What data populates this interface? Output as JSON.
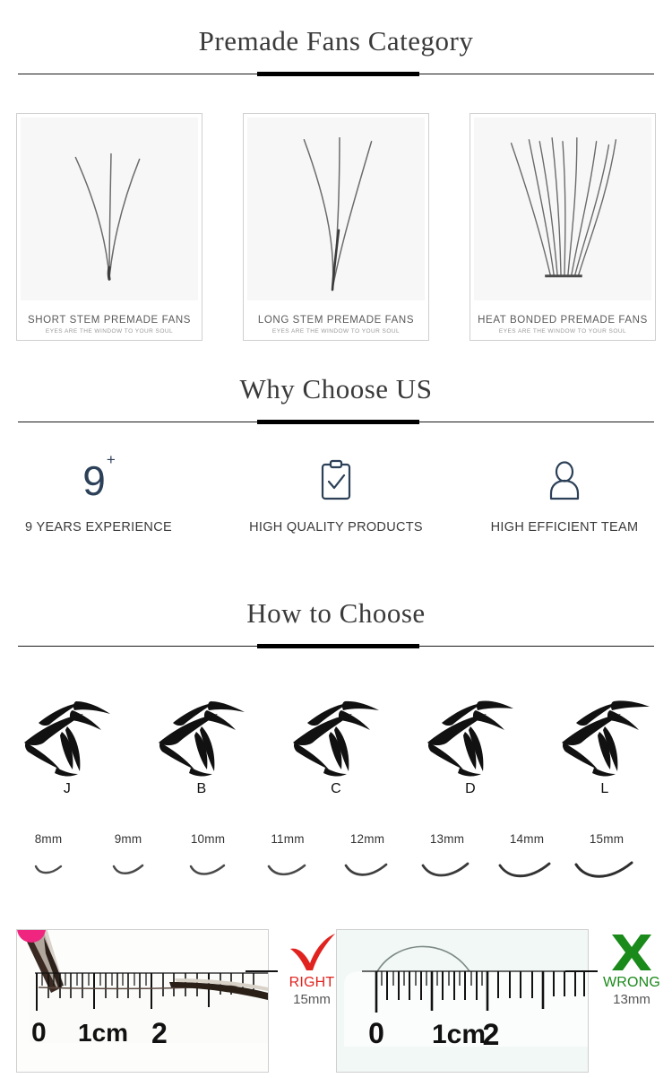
{
  "sections": {
    "category": {
      "title": "Premade Fans Category"
    },
    "why": {
      "title": "Why Choose US"
    },
    "how": {
      "title": "How to Choose"
    }
  },
  "cards": [
    {
      "title": "SHORT STEM PREMADE FANS",
      "subtitle": "EYES ARE THE WINDOW TO YOUR SOUL",
      "icon": "short-stem-fan-illustration"
    },
    {
      "title": "LONG STEM PREMADE FANS",
      "subtitle": "EYES ARE THE WINDOW TO YOUR SOUL",
      "icon": "long-stem-fan-illustration"
    },
    {
      "title": "HEAT BONDED PREMADE FANS",
      "subtitle": "EYES ARE THE WINDOW TO YOUR SOUL",
      "icon": "heat-bonded-fan-illustration"
    }
  ],
  "features": [
    {
      "icon": "nine-plus-number",
      "value": "9",
      "sup": "+",
      "label": "9 YEARS EXPERIENCE"
    },
    {
      "icon": "clipboard-check-icon",
      "label": "HIGH QUALITY PRODUCTS"
    },
    {
      "icon": "person-icon",
      "label": "HIGH EFFICIENT TEAM"
    }
  ],
  "curls": [
    {
      "label": "J"
    },
    {
      "label": "B"
    },
    {
      "label": "C"
    },
    {
      "label": "D"
    },
    {
      "label": "L"
    }
  ],
  "lengths": [
    {
      "value": "8mm"
    },
    {
      "value": "9mm"
    },
    {
      "value": "10mm"
    },
    {
      "value": "11mm"
    },
    {
      "value": "12mm"
    },
    {
      "value": "13mm"
    },
    {
      "value": "14mm"
    },
    {
      "value": "15mm"
    }
  ],
  "comparison": [
    {
      "photo": "ruler-with-tweezers-and-straight-lash",
      "mark": "check-icon",
      "word": "RIGHT",
      "measure": "15mm",
      "color": "#e0231f",
      "ruler_labels": [
        "0",
        "1cm",
        "2"
      ]
    },
    {
      "photo": "ruler-with-curved-lash",
      "mark": "cross-icon",
      "word": "WRONG",
      "measure": "13mm",
      "color": "#1a8a1a",
      "ruler_labels": [
        "0",
        "1cm",
        "2"
      ]
    }
  ],
  "colors": {
    "icon_navy": "#2c4058",
    "rule_black": "#000000",
    "right_red": "#e0231f",
    "wrong_green": "#1a8a1a",
    "measure_gray": "#555555"
  }
}
